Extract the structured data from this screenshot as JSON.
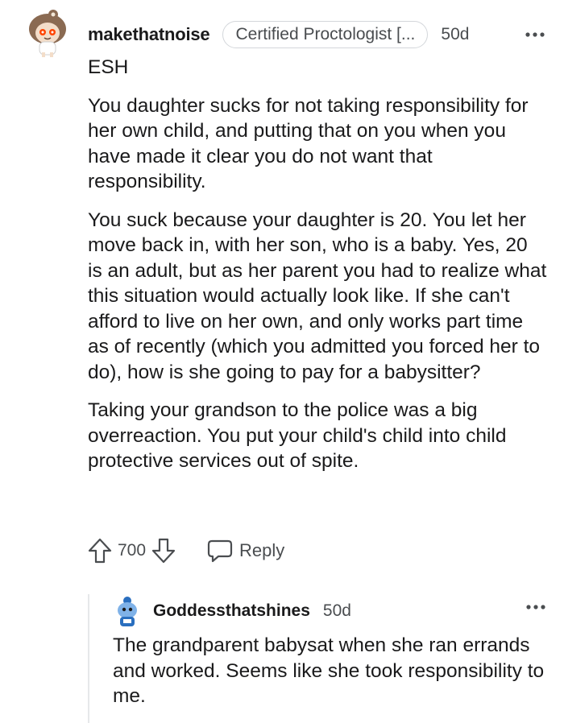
{
  "comment": {
    "username": "makethatnoise",
    "flair": "Certified Proctologist [...",
    "time": "50d",
    "paragraphs": [
      "ESH",
      "You daughter sucks for not taking responsibility for her own child, and putting that on you when you have made it clear you do not want that responsibility.",
      "You suck because your daughter is 20. You let her move back in, with her son, who is a baby. Yes, 20 is an adult, but as her parent you had to realize what this situation would actually look like. If she can't afford to live on her own, and only works part time as of recently (which you admitted you forced her to do), how is she going to pay for a babysitter?",
      "Taking your grandson to the police was a big overreaction. You put your child's child into child protective services out of spite."
    ],
    "score": "700",
    "reply_label": "Reply"
  },
  "reply": {
    "username": "Goddessthatshines",
    "time": "50d",
    "text": "The grandparent babysat when she ran errands and worked. Seems like she took responsibility to me."
  },
  "icons": {
    "upvote": "upvote-arrow-icon",
    "downvote": "downvote-arrow-icon",
    "reply": "speech-bubble-icon",
    "more": "more-options-icon"
  },
  "colors": {
    "text": "#1a1a1b",
    "muted": "#4a4d50",
    "border": "#d3d6da"
  }
}
